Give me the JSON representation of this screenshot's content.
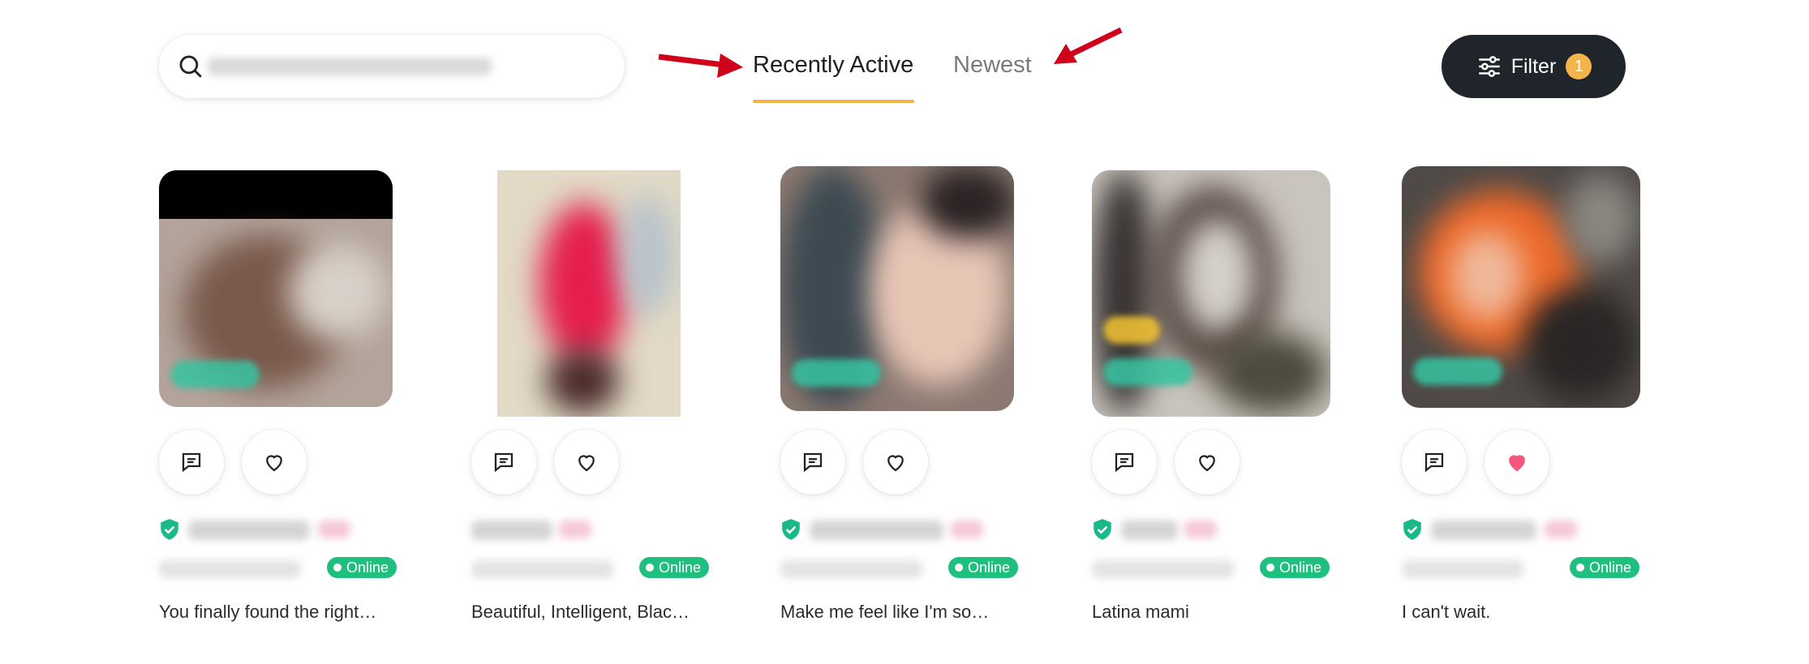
{
  "search": {
    "placeholder": "",
    "value": ""
  },
  "tabs": [
    {
      "label": "Recently Active",
      "active": true
    },
    {
      "label": "Newest",
      "active": false
    }
  ],
  "filter": {
    "label": "Filter",
    "count": "1"
  },
  "colors": {
    "accent": "#f3b54a",
    "dark": "#1f252b",
    "online": "#1fbf7f",
    "verified": "#19b98a",
    "liked": "#f5577c",
    "annotation_arrow": "#d0021b"
  },
  "profiles": [
    {
      "bio": "You finally found the right…",
      "status": "Online",
      "verified": true,
      "liked": false
    },
    {
      "bio": "Beautiful, Intelligent, Blac…",
      "status": "Online",
      "verified": false,
      "liked": false
    },
    {
      "bio": "Make me feel like I'm so…",
      "status": "Online",
      "verified": true,
      "liked": false
    },
    {
      "bio": "Latina mami",
      "status": "Online",
      "verified": true,
      "liked": false
    },
    {
      "bio": "I can't wait.",
      "status": "Online",
      "verified": true,
      "liked": true
    }
  ],
  "icons": {
    "search": "search-icon",
    "filter": "sliders-icon",
    "message": "message-icon",
    "like": "heart-icon",
    "verified": "shield-check-icon"
  }
}
